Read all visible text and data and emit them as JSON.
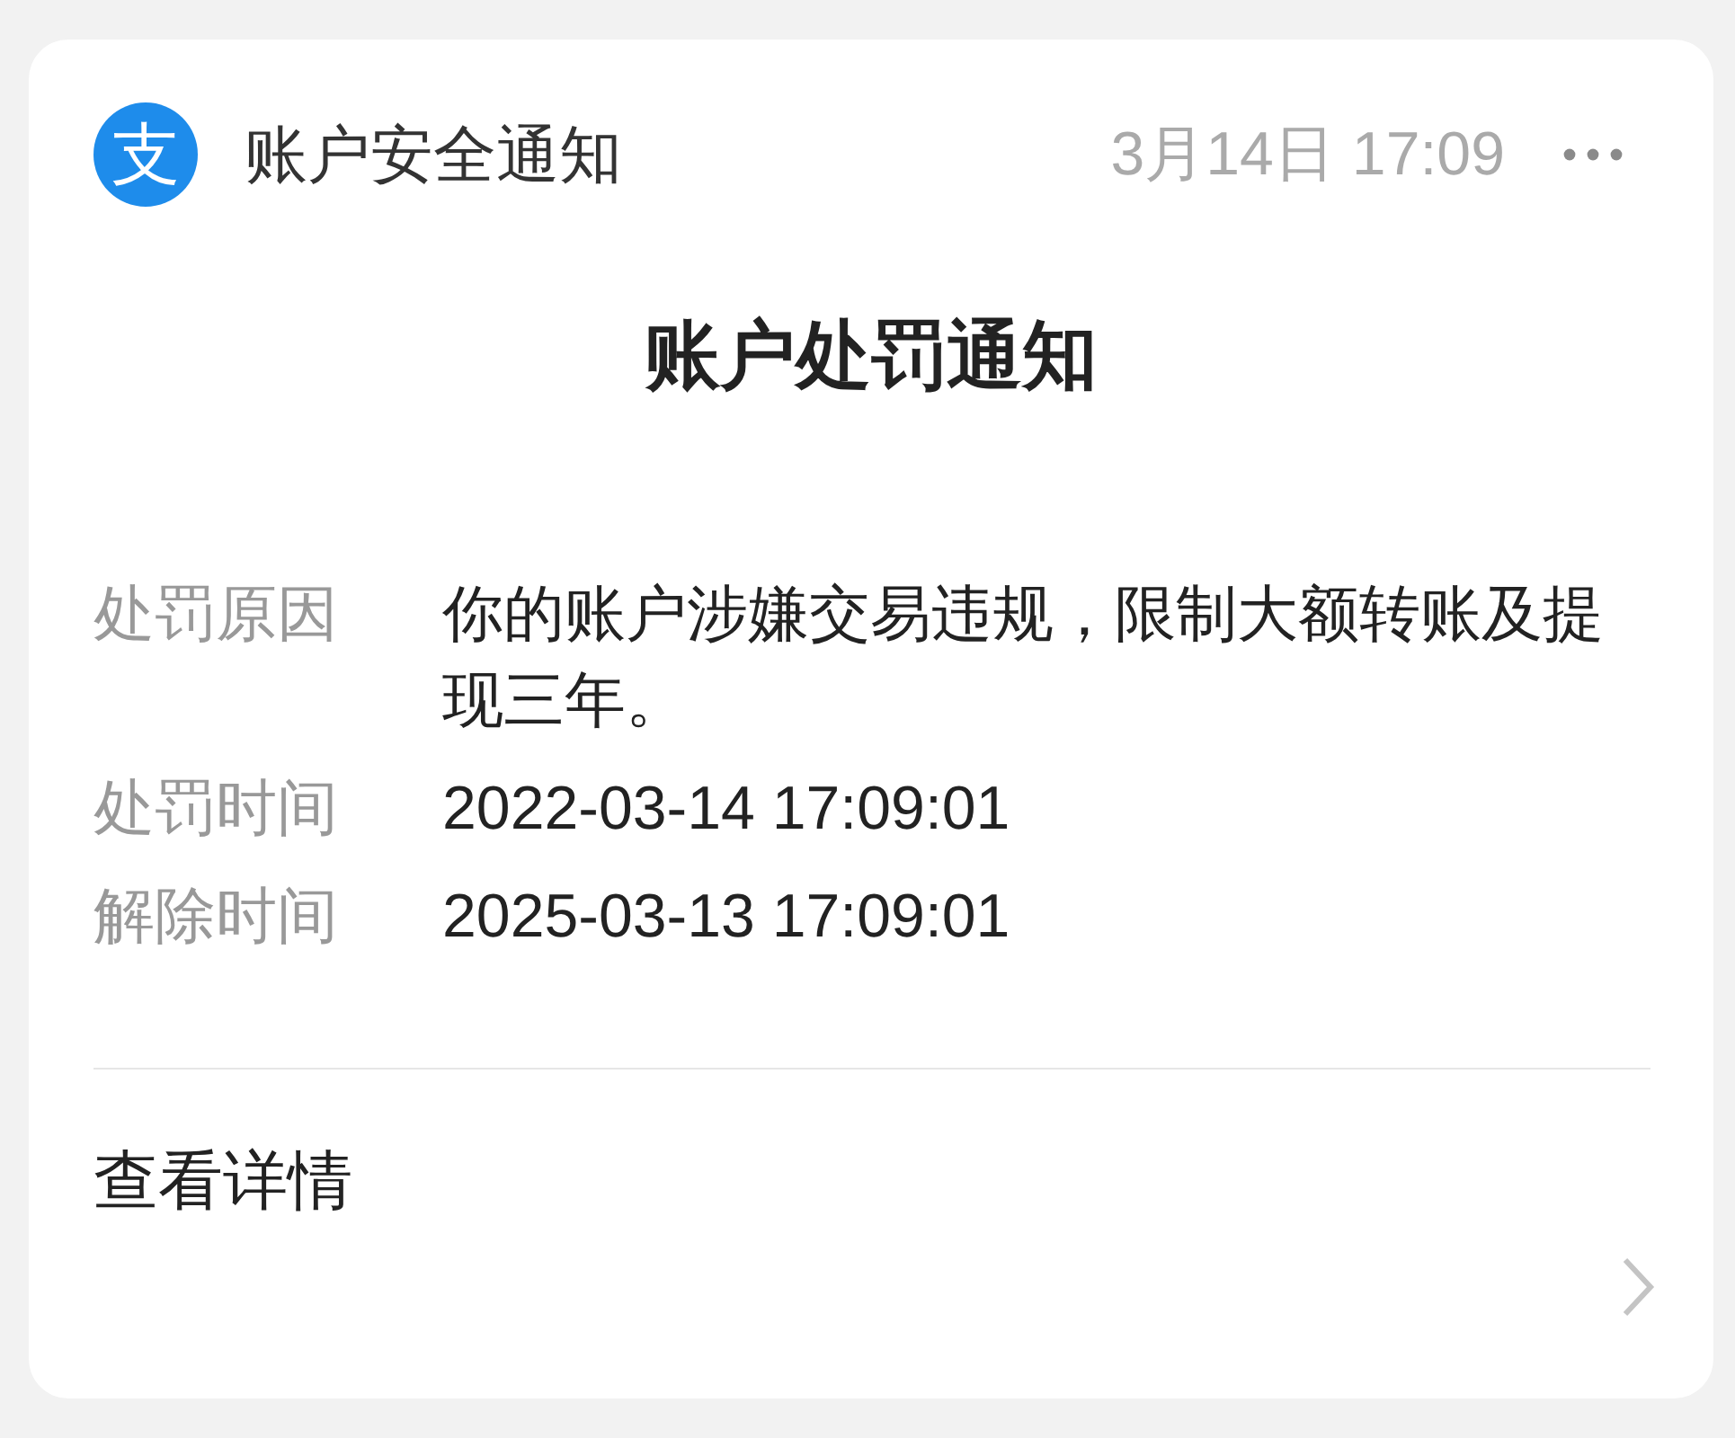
{
  "header": {
    "logo_glyph": "支",
    "source": "账户安全通知",
    "time": "3月14日 17:09"
  },
  "title": "账户处罚通知",
  "fields": [
    {
      "label": "处罚原因",
      "value": "你的账户涉嫌交易违规，限制大额转账及提现三年。"
    },
    {
      "label": "处罚时间",
      "value": "2022-03-14 17:09:01"
    },
    {
      "label": "解除时间",
      "value": "2025-03-13 17:09:01"
    }
  ],
  "footer": {
    "link": "查看详情"
  }
}
